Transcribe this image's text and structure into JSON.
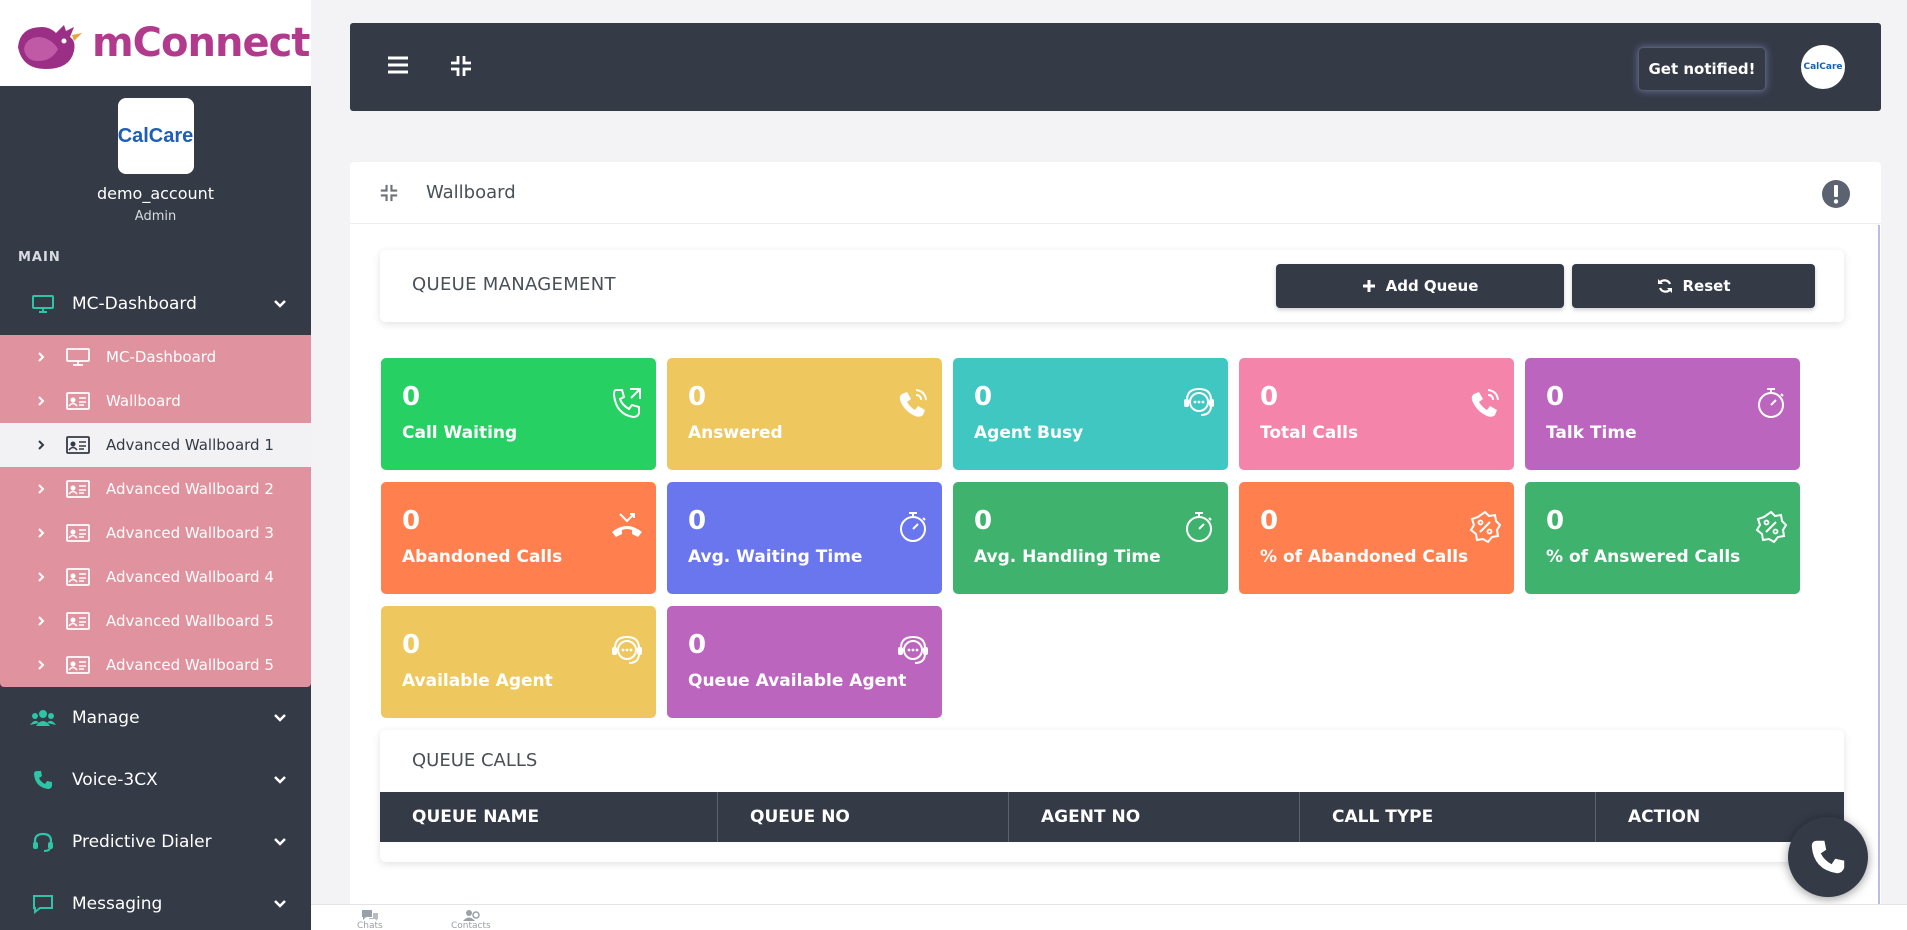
{
  "brand": {
    "logo_text": "mConnect",
    "accent": "#b23a8c"
  },
  "profile": {
    "logo_text": "CalCare",
    "username": "demo_account",
    "role": "Admin"
  },
  "sidebar": {
    "section_label": "MAIN",
    "dashboard_group": {
      "label": "MC-Dashboard",
      "icon": "monitor-icon"
    },
    "submenu": [
      {
        "label": "MC-Dashboard",
        "icon": "monitor-icon",
        "active": false
      },
      {
        "label": "Wallboard",
        "icon": "id-card-icon",
        "active": false
      },
      {
        "label": "Advanced Wallboard 1",
        "icon": "id-card-icon",
        "active": true
      },
      {
        "label": "Advanced Wallboard 2",
        "icon": "id-card-icon",
        "active": false
      },
      {
        "label": "Advanced Wallboard 3",
        "icon": "id-card-icon",
        "active": false
      },
      {
        "label": "Advanced Wallboard 4",
        "icon": "id-card-icon",
        "active": false
      },
      {
        "label": "Advanced Wallboard 5",
        "icon": "id-card-icon",
        "active": false
      },
      {
        "label": "Advanced Wallboard 5",
        "icon": "id-card-icon",
        "active": false
      }
    ],
    "groups": [
      {
        "label": "Manage",
        "icon": "users-icon"
      },
      {
        "label": "Voice-3CX",
        "icon": "phone-icon"
      },
      {
        "label": "Predictive Dialer",
        "icon": "headset-icon"
      },
      {
        "label": "Messaging",
        "icon": "chat-icon"
      }
    ]
  },
  "topbar": {
    "notify_label": "Get notified!",
    "avatar_text": "CalCare"
  },
  "card": {
    "title": "Wallboard"
  },
  "queue_management": {
    "title": "QUEUE MANAGEMENT",
    "add_label": "Add Queue",
    "reset_label": "Reset"
  },
  "tiles": [
    {
      "value": "0",
      "label": "Call Waiting",
      "color": "#27d063",
      "icon": "phone-forward-icon"
    },
    {
      "value": "0",
      "label": "Answered",
      "color": "#eec75f",
      "icon": "phone-ringing-icon"
    },
    {
      "value": "0",
      "label": "Agent Busy",
      "color": "#40c7c2",
      "icon": "headset-icon"
    },
    {
      "value": "0",
      "label": "Total Calls",
      "color": "#f484aa",
      "icon": "phone-ringing-icon"
    },
    {
      "value": "0",
      "label": "Talk Time",
      "color": "#bb65bf",
      "icon": "stopwatch-icon"
    },
    {
      "value": "0",
      "label": "Abandoned Calls",
      "color": "#ff804e",
      "icon": "phone-hangup-icon"
    },
    {
      "value": "0",
      "label": "Avg. Waiting Time",
      "color": "#6a76ee",
      "icon": "stopwatch-icon"
    },
    {
      "value": "0",
      "label": "Avg. Handling Time",
      "color": "#3fb36e",
      "icon": "stopwatch-icon"
    },
    {
      "value": "0",
      "label": "% of Abandoned Calls",
      "color": "#ff804e",
      "icon": "percent-badge-icon"
    },
    {
      "value": "0",
      "label": "% of Answered Calls",
      "color": "#3fb36e",
      "icon": "percent-badge-icon"
    },
    {
      "value": "0",
      "label": "Available Agent",
      "color": "#eec75f",
      "icon": "headset-icon"
    },
    {
      "value": "0",
      "label": "Queue Available Agent",
      "color": "#bb65bf",
      "icon": "headset-icon"
    }
  ],
  "queue_calls": {
    "title": "QUEUE CALLS",
    "columns": [
      "QUEUE NAME",
      "QUEUE NO",
      "AGENT NO",
      "CALL TYPE",
      "ACTION"
    ]
  },
  "bottom_bar": {
    "items": [
      "Chats",
      "Contacts"
    ]
  }
}
